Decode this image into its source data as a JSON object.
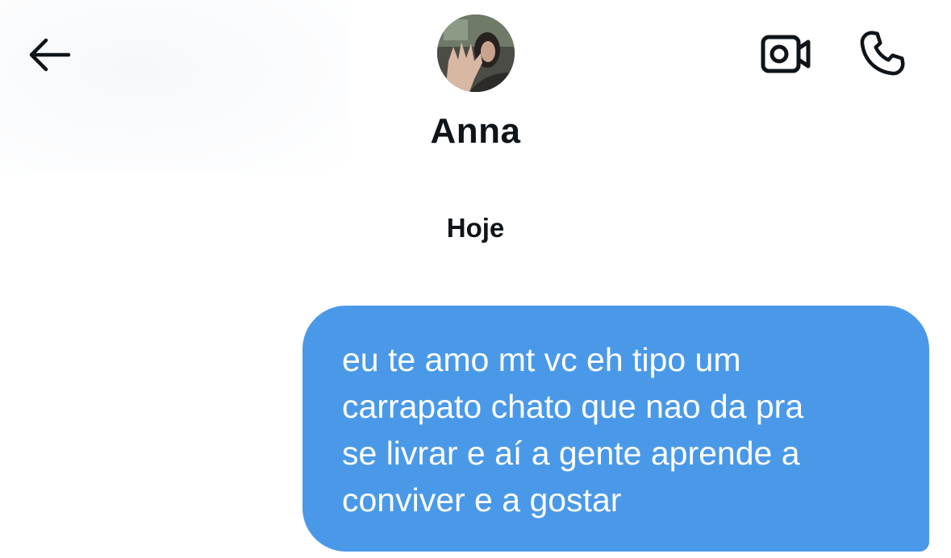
{
  "header": {
    "contact_name": "Anna",
    "back_icon": "arrow-left-icon",
    "video_icon": "video-camera-icon",
    "phone_icon": "phone-icon"
  },
  "conversation": {
    "date_label": "Hoje",
    "messages": [
      {
        "direction": "sent",
        "text": "eu te amo mt vc eh tipo um\ncarrapato chato que nao da pra\nse livrar e aí a gente aprende a\nconviver e a gostar"
      }
    ]
  },
  "colors": {
    "sent_bubble": "#4a99e9",
    "text_primary": "#0f1419",
    "icon": "#0f1419"
  }
}
